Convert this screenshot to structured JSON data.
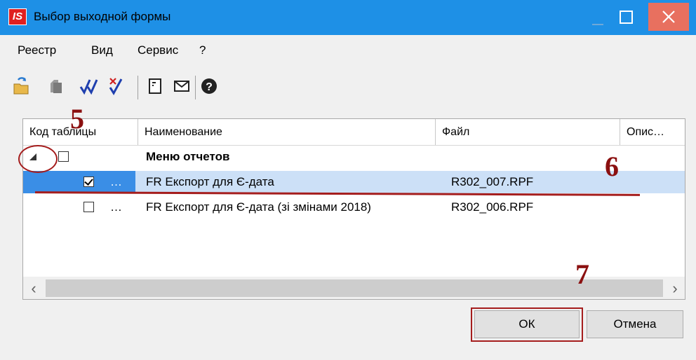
{
  "window": {
    "title": "Выбор выходной формы",
    "logo": "IS"
  },
  "menu": [
    "Реестр",
    "Вид",
    "Сервис",
    "?"
  ],
  "toolbar": [
    "folder-open-icon",
    "folder-grey-icon",
    "check-all-icon",
    "uncheck-all-icon",
    "form-icon",
    "envelope-icon",
    "help-icon"
  ],
  "grid": {
    "columns": [
      "Код таблицы",
      "Наименование",
      "Файл",
      "Опис…"
    ],
    "group": {
      "label": "Меню отчетов"
    },
    "rows": [
      {
        "checked": true,
        "dots": "…",
        "name": "FR Експорт для Є-дата",
        "file": "R302_007.RPF"
      },
      {
        "checked": false,
        "dots": "…",
        "name": "FR Експорт для Є-дата (зі змінами 2018)",
        "file": "R302_006.RPF"
      }
    ]
  },
  "buttons": {
    "ok": "ОК",
    "cancel": "Отмена"
  },
  "annotations": {
    "a5": "5",
    "a6": "6",
    "a7": "7"
  },
  "colors": {
    "titlebar": "#1e90e6",
    "selection": "#cce0f7",
    "annotation": "#a51d1d"
  }
}
